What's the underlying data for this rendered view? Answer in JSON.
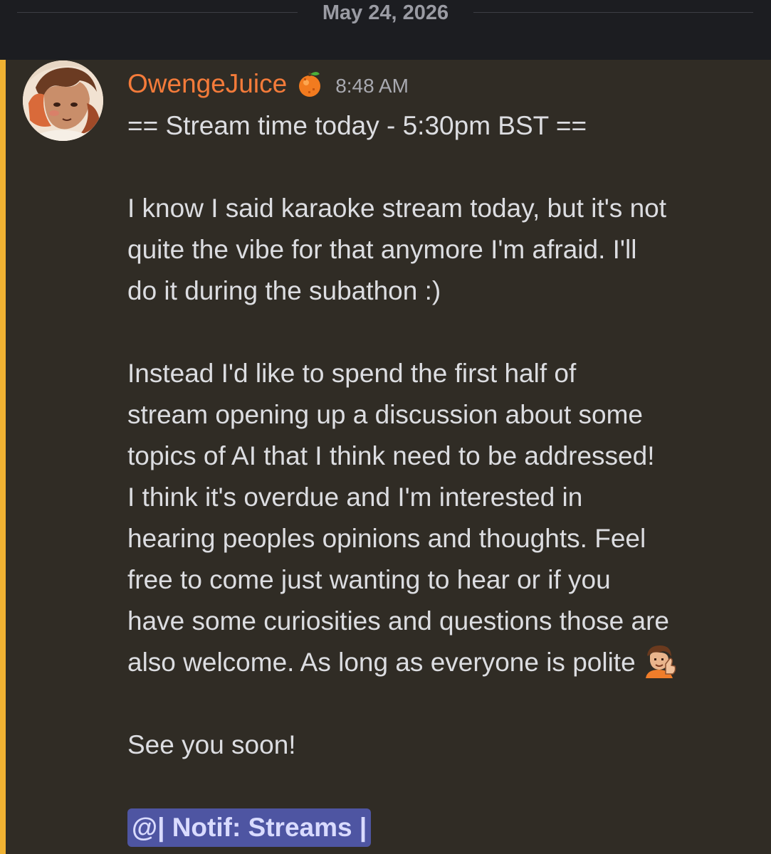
{
  "date_divider": {
    "date": "May 24, 2026"
  },
  "message": {
    "author": "OwengeJuice",
    "author_color": "#f47b3a",
    "author_badge_icon": "orange-emoji-icon",
    "timestamp": "8:48 AM",
    "highlight_color": "#f0b232",
    "lines": {
      "l1": "== Stream time today - 5:30pm BST ==",
      "l2": "I know I said karaoke stream today, but it's not",
      "l3": "quite the vibe for that anymore I'm afraid. I'll",
      "l4": "do it during the subathon :)",
      "l5": "Instead I'd like to spend the first half of",
      "l6": "stream opening up a discussion about some",
      "l7": "topics of AI that I think need to be addressed!",
      "l8": "I think it's overdue and I'm interested in",
      "l9": "hearing peoples opinions and thoughts. Feel",
      "l10": "free to come just wanting to hear or if you",
      "l11": "have some curiosities and questions those are",
      "l12": "also welcome. As long as everyone is polite",
      "l13": "See you soon!"
    },
    "inline_emoji_icon": "thumbs-up-emoji-icon",
    "role_mention": "@| Notif: Streams |",
    "mention_color": "#4e55a2"
  }
}
